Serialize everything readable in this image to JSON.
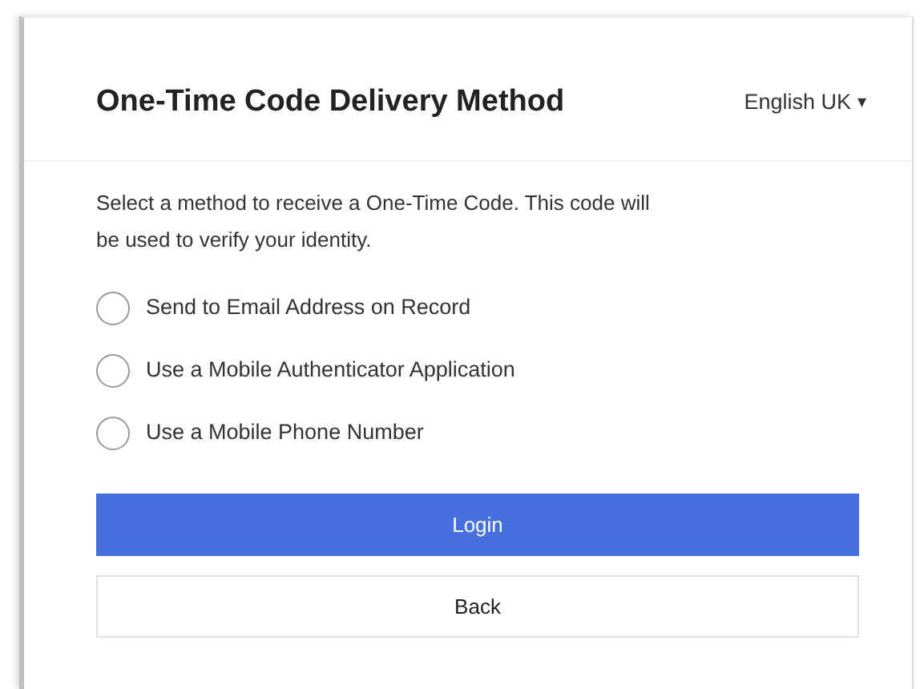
{
  "card": {
    "title": "One-Time Code Delivery Method",
    "language": {
      "label": "English UK",
      "caret": "▾"
    },
    "instructions": "Select a method to receive a One-Time Code. This code will be used to verify your identity.",
    "options": [
      {
        "label": "Send to Email Address on Record",
        "selected": false
      },
      {
        "label": "Use a Mobile Authenticator Application",
        "selected": false
      },
      {
        "label": "Use a Mobile Phone Number",
        "selected": false
      }
    ],
    "buttons": [
      {
        "label": "Login",
        "kind": "primary"
      },
      {
        "label": "Back",
        "kind": "secondary"
      }
    ]
  }
}
